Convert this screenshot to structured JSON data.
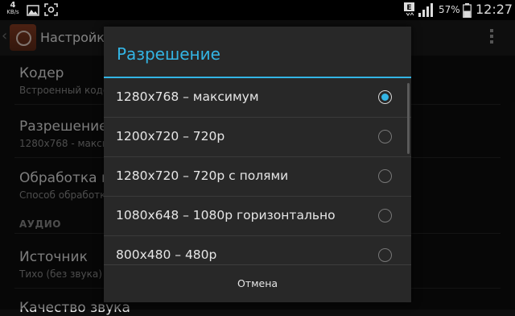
{
  "status_bar": {
    "net_speed_value": "4",
    "net_speed_unit": "KB/s",
    "notification_icons": [
      "image-icon",
      "screenshot-icon"
    ],
    "network_type": "E",
    "battery_percent": "57%",
    "time": "12:27"
  },
  "action_bar": {
    "title": "Настройки"
  },
  "background_settings": {
    "items": [
      {
        "title": "Кодер",
        "summary": "Встроенный кодер"
      },
      {
        "title": "Разрешение",
        "summary": "1280x768 - максимум"
      },
      {
        "title": "Обработка изображения",
        "summary": "Способ обработки"
      }
    ],
    "section_audio": "АУДИО",
    "audio_items": [
      {
        "title": "Источник",
        "summary": "Тихо (без звука)"
      },
      {
        "title": "Качество звука",
        "summary": ""
      }
    ]
  },
  "dialog": {
    "title": "Разрешение",
    "options": [
      {
        "label": "1280x768 – максимум",
        "selected": true
      },
      {
        "label": "1200x720 – 720p",
        "selected": false
      },
      {
        "label": "1280x720 – 720p с полями",
        "selected": false
      },
      {
        "label": "1080x648 – 1080p горизонтально",
        "selected": false
      },
      {
        "label": "800x480 – 480p",
        "selected": false
      }
    ],
    "cancel_label": "Отмена"
  },
  "colors": {
    "accent": "#33b5e5",
    "dialog_bg": "#282828",
    "app_icon": "#7a3420"
  }
}
